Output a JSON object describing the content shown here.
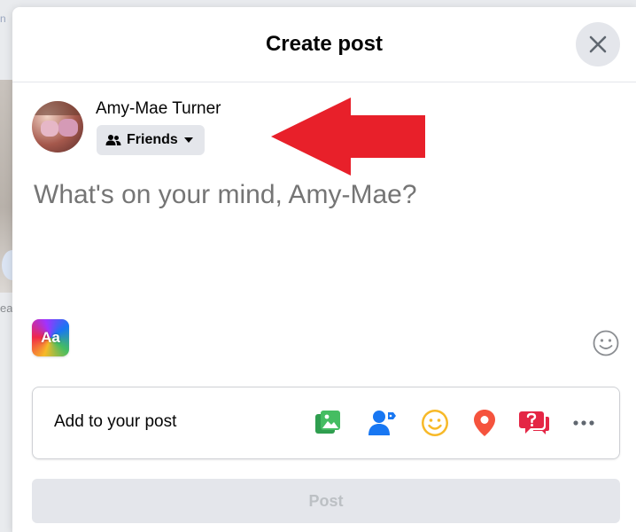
{
  "background": {
    "top_text": "n",
    "side_text": "ea"
  },
  "modal": {
    "title": "Create post",
    "close_icon": "close-icon"
  },
  "author": {
    "name": "Amy-Mae Turner",
    "audience": "Friends",
    "audience_icon": "friends-icon"
  },
  "composer": {
    "placeholder": "What's on your mind, Amy-Mae?"
  },
  "background_picker": {
    "label": "Aa"
  },
  "add_to_post": {
    "label": "Add to your post",
    "icons": [
      "photo-video-icon",
      "tag-people-icon",
      "feeling-icon",
      "check-in-icon",
      "question-icon",
      "more-icon"
    ]
  },
  "post_button": {
    "label": "Post",
    "enabled": false
  },
  "colors": {
    "accent_blue": "#1877f2",
    "photo_green": "#45bd62",
    "feeling_yellow": "#f7b928",
    "checkin_red": "#f5533d",
    "question_red": "#e42645",
    "annotation_red": "#e8202a"
  }
}
